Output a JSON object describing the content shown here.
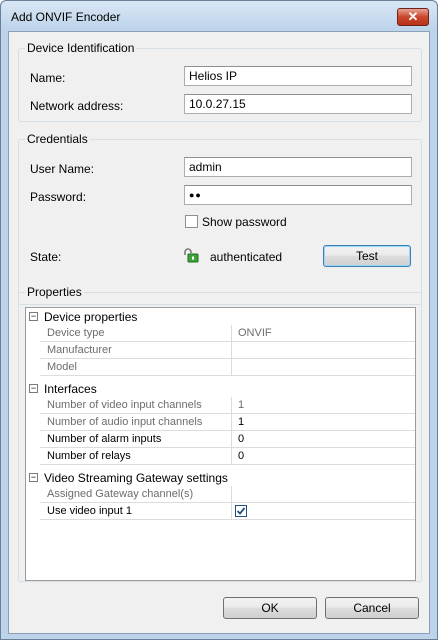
{
  "window": {
    "title": "Add ONVIF Encoder",
    "close_glyph": "✕"
  },
  "device_identification": {
    "title": "Device Identification",
    "name_label": "Name:",
    "name_value": "Helios IP",
    "address_label": "Network address:",
    "address_value": "10.0.27.15"
  },
  "credentials": {
    "title": "Credentials",
    "user_label": "User Name:",
    "user_value": "admin",
    "password_label": "Password:",
    "password_value": "●●",
    "show_password_label": "Show password",
    "show_password_checked": false,
    "state_label": "State:",
    "state_icon": "unlocked-padlock-icon",
    "state_value": "authenticated",
    "test_label": "Test"
  },
  "properties": {
    "title": "Properties",
    "categories": [
      {
        "label": "Device properties",
        "toggle": "−",
        "rows": [
          {
            "name": "Device type",
            "value": "ONVIF",
            "readonly": true
          },
          {
            "name": "Manufacturer",
            "value": "",
            "readonly": true
          },
          {
            "name": "Model",
            "value": "",
            "readonly": true
          }
        ]
      },
      {
        "label": "Interfaces",
        "toggle": "−",
        "rows": [
          {
            "name": "Number of video input channels",
            "value": "1",
            "readonly": true
          },
          {
            "name": "Number of audio input channels",
            "value": "1",
            "readonly": true
          },
          {
            "name": "Number of alarm inputs",
            "value": "0",
            "readonly": false
          },
          {
            "name": "Number of relays",
            "value": "0",
            "readonly": false
          }
        ]
      },
      {
        "label": "Video Streaming Gateway settings",
        "toggle": "−",
        "rows": [
          {
            "name": "Assigned Gateway channel(s)",
            "value": "",
            "readonly": true
          },
          {
            "name": "Use video input 1",
            "value": "",
            "readonly": false,
            "checkbox": true,
            "checked": true
          }
        ]
      }
    ]
  },
  "buttons": {
    "ok": "OK",
    "cancel": "Cancel"
  },
  "colors": {
    "accent": "#3c7fb1",
    "close": "#c9462c",
    "checkmark": "#1c5180"
  }
}
